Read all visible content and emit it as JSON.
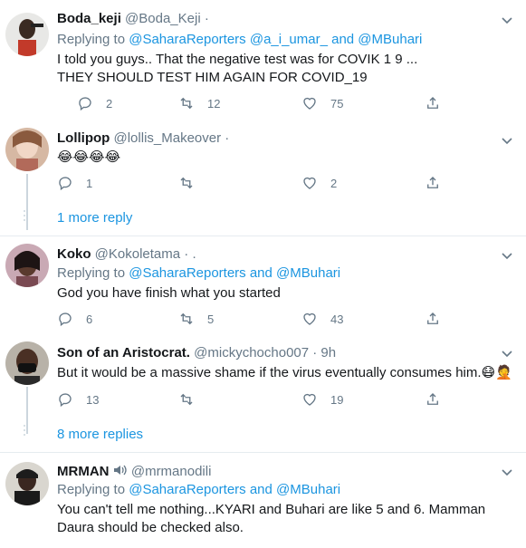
{
  "colors": {
    "accent": "#1b95e0",
    "muted": "#657786",
    "text": "#14171a",
    "divider": "#e6ecf0"
  },
  "tweets": [
    {
      "name": "Boda_keji",
      "handle": "@Boda_Keji",
      "meta": " ·",
      "replying_prefix": "Replying to ",
      "replying_mentions": "@SaharaReporters @a_i_umar_ and @MBuhari",
      "lines": [
        "I told you guys.. That the negative test was for COVIK 1 9 ...",
        "THEY SHOULD TEST HIM AGAIN FOR COVID_19"
      ],
      "replies": "2",
      "retweets": "12",
      "likes": "75"
    },
    {
      "name": "Lollipop",
      "handle": "@lollis_Makeover",
      "meta": " ·",
      "emoji_text": "😂😂😂😂",
      "replies": "1",
      "retweets": "",
      "likes": "2"
    },
    {
      "name": "Koko",
      "handle": "@Kokoletama",
      "meta": " · .",
      "replying_prefix": "Replying to ",
      "replying_mentions": "@SaharaReporters and @MBuhari",
      "lines": [
        "God you have finish what you started"
      ],
      "replies": "6",
      "retweets": "5",
      "likes": "43"
    },
    {
      "name": "Son of an Aristocrat.",
      "handle": "@mickychocho007",
      "meta": " · 9h",
      "lines": [
        "But it would be a massive shame if the virus eventually consumes him."
      ],
      "emoji_suffix": "😷🤦",
      "replies": "13",
      "retweets": "",
      "likes": "19"
    },
    {
      "name": "MRMAN",
      "handle": "@mrmanodili",
      "meta": "",
      "replying_prefix": "Replying to ",
      "replying_mentions": "@SaharaReporters and @MBuhari",
      "lines": [
        "You can't tell me nothing...KYARI and Buhari are like 5 and 6. Mamman",
        "Daura should be checked also."
      ],
      "replies": "",
      "retweets": "",
      "likes": ""
    }
  ],
  "more_replies": [
    "1 more reply",
    "8 more replies"
  ]
}
